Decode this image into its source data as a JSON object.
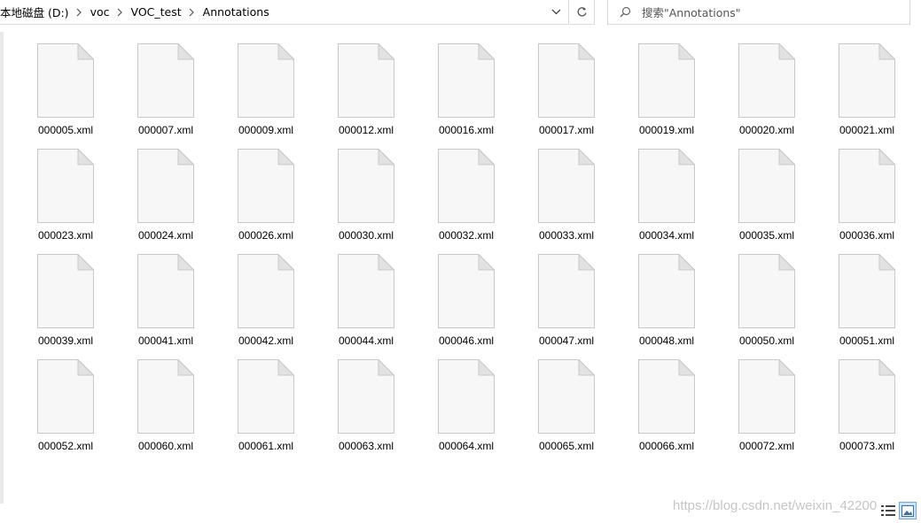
{
  "address_bar": {
    "breadcrumbs": [
      "本地磁盘 (D:)",
      "voc",
      "VOC_test",
      "Annotations"
    ]
  },
  "search": {
    "placeholder": "搜索\"Annotations\""
  },
  "files": [
    "000005.xml",
    "000007.xml",
    "000009.xml",
    "000012.xml",
    "000016.xml",
    "000017.xml",
    "000019.xml",
    "000020.xml",
    "000021.xml",
    "000023.xml",
    "000024.xml",
    "000026.xml",
    "000030.xml",
    "000032.xml",
    "000033.xml",
    "000034.xml",
    "000035.xml",
    "000036.xml",
    "000039.xml",
    "000041.xml",
    "000042.xml",
    "000044.xml",
    "000046.xml",
    "000047.xml",
    "000048.xml",
    "000050.xml",
    "000051.xml",
    "000052.xml",
    "000060.xml",
    "000061.xml",
    "000063.xml",
    "000064.xml",
    "000065.xml",
    "000066.xml",
    "000072.xml",
    "000073.xml"
  ],
  "file_icon": "document-icon",
  "watermark": "https://blog.csdn.net/weixin_42200",
  "colors": {
    "border": "#d9d9d9",
    "selected_view": "#cce4f7",
    "selected_view_border": "#7aa7d6"
  }
}
